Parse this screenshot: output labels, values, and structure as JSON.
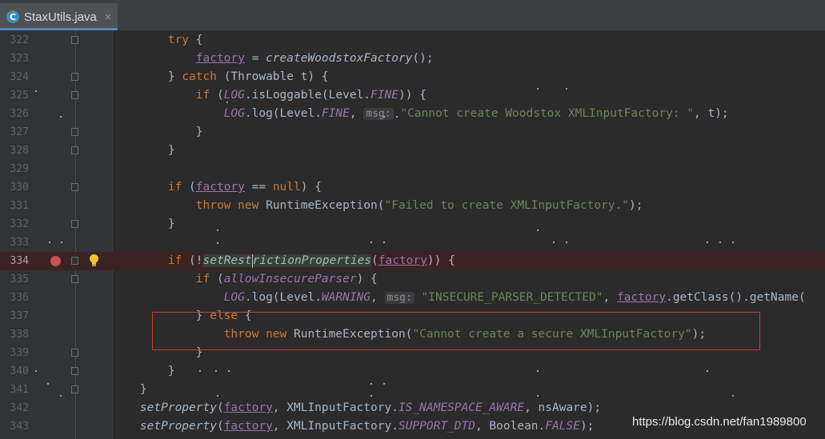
{
  "tab": {
    "title": "StaxUtils.java",
    "close": "×"
  },
  "lines": [
    {
      "n": "322",
      "fold": true,
      "parts": [
        [
          "p",
          "        "
        ],
        [
          "kw",
          "try"
        ],
        [
          "p",
          " {"
        ]
      ]
    },
    {
      "n": "323",
      "fold": false,
      "parts": [
        [
          "p",
          "            "
        ],
        [
          "fldu",
          "factory"
        ],
        [
          "p",
          " = "
        ],
        [
          "st",
          "createWoodstoxFactory"
        ],
        [
          "p",
          "();"
        ]
      ]
    },
    {
      "n": "324",
      "fold": true,
      "parts": [
        [
          "p",
          "        } "
        ],
        [
          "kw",
          "catch"
        ],
        [
          "p",
          " (Throwable t) {"
        ]
      ]
    },
    {
      "n": "325",
      "fold": true,
      "parts": [
        [
          "p",
          "            "
        ],
        [
          "kw",
          "if"
        ],
        [
          "p",
          " ("
        ],
        [
          "fldi",
          "LOG"
        ],
        [
          "p",
          ".isLoggable(Level."
        ],
        [
          "fldi",
          "FINE"
        ],
        [
          "p",
          ")) {"
        ]
      ]
    },
    {
      "n": "326",
      "fold": false,
      "parts": [
        [
          "p",
          "                "
        ],
        [
          "fldi",
          "LOG"
        ],
        [
          "p",
          ".log(Level."
        ],
        [
          "fldi",
          "FINE"
        ],
        [
          "p",
          ", "
        ],
        [
          "hint",
          "msg:"
        ],
        [
          "str",
          " \"Cannot create Woodstox XMLInputFactory: \""
        ],
        [
          "p",
          ", t);"
        ]
      ]
    },
    {
      "n": "327",
      "fold": true,
      "parts": [
        [
          "p",
          "            }"
        ]
      ]
    },
    {
      "n": "328",
      "fold": true,
      "parts": [
        [
          "p",
          "        }"
        ]
      ]
    },
    {
      "n": "329",
      "fold": false,
      "parts": []
    },
    {
      "n": "330",
      "fold": true,
      "parts": [
        [
          "p",
          "        "
        ],
        [
          "kw",
          "if"
        ],
        [
          "p",
          " ("
        ],
        [
          "fldu",
          "factory"
        ],
        [
          "p",
          " == "
        ],
        [
          "kw",
          "null"
        ],
        [
          "p",
          ") {"
        ]
      ]
    },
    {
      "n": "331",
      "fold": false,
      "parts": [
        [
          "p",
          "            "
        ],
        [
          "kw",
          "throw new"
        ],
        [
          "p",
          " RuntimeException("
        ],
        [
          "str",
          "\"Failed to create XMLInputFactory.\""
        ],
        [
          "p",
          ");"
        ]
      ]
    },
    {
      "n": "332",
      "fold": true,
      "parts": [
        [
          "p",
          "        }"
        ]
      ]
    },
    {
      "n": "333",
      "fold": false,
      "parts": []
    },
    {
      "n": "334",
      "fold": true,
      "bp": true,
      "bulb": true,
      "parts": [
        [
          "p",
          "        "
        ],
        [
          "kw",
          "if"
        ],
        [
          "p",
          " (!"
        ],
        [
          "hlst",
          "setRestrictionProperties"
        ],
        [
          "p",
          "("
        ],
        [
          "fldu",
          "factory"
        ],
        [
          "p",
          ")) {"
        ]
      ]
    },
    {
      "n": "335",
      "fold": true,
      "parts": [
        [
          "p",
          "            "
        ],
        [
          "kw",
          "if"
        ],
        [
          "p",
          " ("
        ],
        [
          "fldi",
          "allowInsecureParser"
        ],
        [
          "p",
          ") {"
        ]
      ]
    },
    {
      "n": "336",
      "fold": false,
      "parts": [
        [
          "p",
          "                "
        ],
        [
          "fldi",
          "LOG"
        ],
        [
          "p",
          ".log(Level."
        ],
        [
          "fldi",
          "WARNING"
        ],
        [
          "p",
          ", "
        ],
        [
          "hint",
          "msg:"
        ],
        [
          "str",
          " \"INSECURE_PARSER_DETECTED\""
        ],
        [
          "p",
          ", "
        ],
        [
          "fldu",
          "factory"
        ],
        [
          "p",
          ".getClass().getName("
        ]
      ]
    },
    {
      "n": "337",
      "fold": false,
      "parts": [
        [
          "p",
          "            } "
        ],
        [
          "kw",
          "else"
        ],
        [
          "p",
          " {"
        ]
      ]
    },
    {
      "n": "338",
      "fold": false,
      "parts": [
        [
          "p",
          "                "
        ],
        [
          "kw",
          "throw new"
        ],
        [
          "p",
          " RuntimeException("
        ],
        [
          "str",
          "\"Cannot create a secure XMLInputFactory\""
        ],
        [
          "p",
          ");"
        ]
      ]
    },
    {
      "n": "339",
      "fold": true,
      "parts": [
        [
          "p",
          "            }"
        ]
      ]
    },
    {
      "n": "340",
      "fold": true,
      "parts": [
        [
          "p",
          "        }"
        ]
      ]
    },
    {
      "n": "341",
      "fold": true,
      "parts": [
        [
          "p",
          "    }"
        ]
      ]
    },
    {
      "n": "342",
      "fold": false,
      "parts": [
        [
          "p",
          "    "
        ],
        [
          "st",
          "setProperty"
        ],
        [
          "p",
          "("
        ],
        [
          "fldu",
          "factory"
        ],
        [
          "p",
          ", XMLInputFactory."
        ],
        [
          "fldi",
          "IS_NAMESPACE_AWARE"
        ],
        [
          "p",
          ", nsAware);"
        ]
      ]
    },
    {
      "n": "343",
      "fold": false,
      "parts": [
        [
          "p",
          "    "
        ],
        [
          "st",
          "setProperty"
        ],
        [
          "p",
          "("
        ],
        [
          "fldu",
          "factory"
        ],
        [
          "p",
          ", XMLInputFactory."
        ],
        [
          "fldi",
          "SUPPORT_DTD"
        ],
        [
          "p",
          ", Boolean."
        ],
        [
          "fldi",
          "FALSE"
        ],
        [
          "p",
          ");"
        ]
      ]
    }
  ],
  "watermark": "https://blog.csdn.net/fan1989800",
  "colors": {
    "breakpoint": "#c75450",
    "highlight_box": "#d03a2f",
    "accent": "#4a88c7"
  }
}
